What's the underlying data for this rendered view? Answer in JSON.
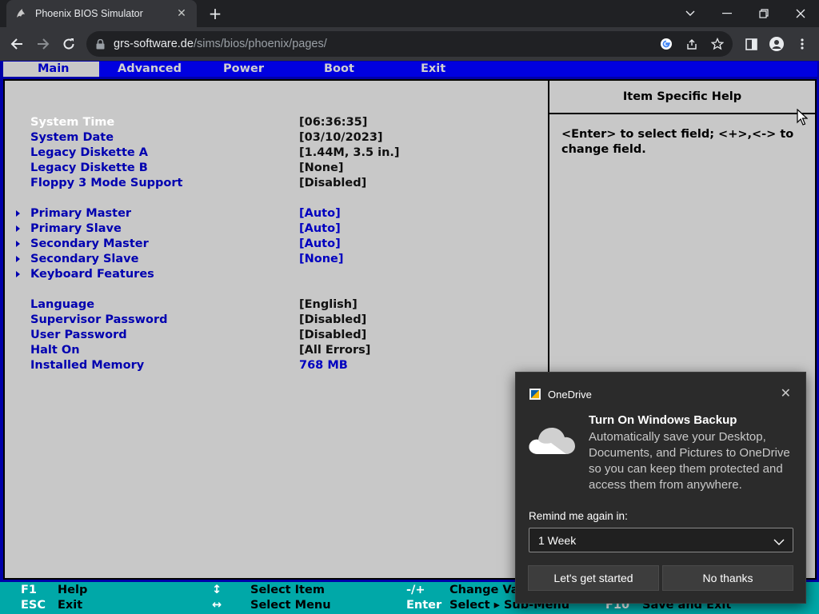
{
  "browser": {
    "tab_title": "Phoenix BIOS Simulator",
    "tab_close": "✕",
    "new_tab": "+",
    "url_host": "grs-software.de",
    "url_path": "/sims/bios/phoenix/pages/"
  },
  "bios": {
    "menu": [
      {
        "label": "Main",
        "active": true
      },
      {
        "label": "Advanced"
      },
      {
        "label": "Power"
      },
      {
        "label": "Boot"
      },
      {
        "label": "Exit"
      }
    ],
    "help_title": "Item Specific Help",
    "help_text": "<Enter> to select field; <+>,<-> to change field.",
    "rows": [
      {
        "label": "System Time",
        "value": "[06:36:35]"
      },
      {
        "label": "System Date",
        "value": "[03/10/2023]"
      },
      {
        "label": "Legacy Diskette A",
        "value": "[1.44M, 3.5 in.]"
      },
      {
        "label": "Legacy Diskette B",
        "value": "[None]"
      },
      {
        "label": "Floppy 3 Mode Support",
        "value": "[Disabled]"
      },
      {
        "label": "Primary Master",
        "value": "[Auto]"
      },
      {
        "label": "Primary Slave",
        "value": "[Auto]"
      },
      {
        "label": "Secondary Master",
        "value": "[Auto]"
      },
      {
        "label": "Secondary Slave",
        "value": "[None]"
      },
      {
        "label": "Keyboard Features",
        "value": ""
      },
      {
        "label": "Language",
        "value": "[English]"
      },
      {
        "label": "Supervisor Password",
        "value": "[Disabled]"
      },
      {
        "label": "User Password",
        "value": "[Disabled]"
      },
      {
        "label": "Halt On",
        "value": "[All Errors]"
      },
      {
        "label": "Installed Memory",
        "value": "768 MB"
      }
    ],
    "status": {
      "f1_key": "F1",
      "f1_txt": "Help",
      "esc_key": "ESC",
      "esc_txt": "Exit",
      "updown_key": "↕",
      "updown_txt": "Select Item",
      "lr_key": "↔",
      "lr_txt": "Select Menu",
      "pm_key": "-/+",
      "pm_txt": "Change Val",
      "enter_key": "Enter",
      "enter_txt": "Select ▸ Sub-Menu",
      "f10_key": "F10",
      "f10_txt": "Save and Exit"
    }
  },
  "toast": {
    "app_name": "OneDrive",
    "close": "✕",
    "title": "Turn On Windows Backup",
    "body": "Automatically save your Desktop, Documents, and Pictures to OneDrive so you can keep them protected and access them from anywhere.",
    "remind_label": "Remind me again in:",
    "remind_value": "1 Week",
    "primary_button": "Let's get started",
    "secondary_button": "No thanks"
  },
  "colors": {
    "bios_blue": "#0000a8",
    "bios_panel": "#c8c8c8",
    "status_cyan": "#00a8a8"
  }
}
